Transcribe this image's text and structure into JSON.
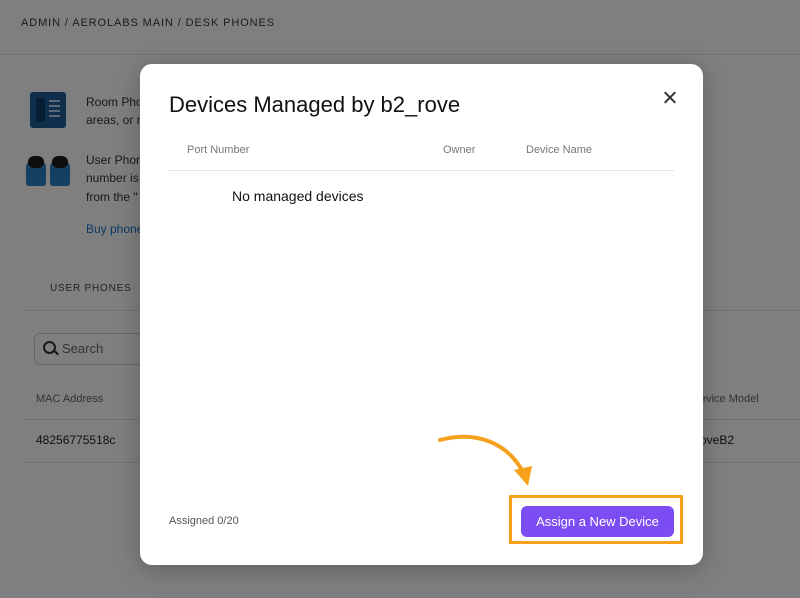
{
  "background": {
    "breadcrumb": "ADMIN / AEROLABS MAIN / DESK PHONES",
    "room_phones_heading": "Room Phon",
    "room_phones_desc": "areas, or r",
    "user_phones_heading": "User Phon",
    "user_phones_desc_1": "number is",
    "user_phones_desc_2": "from the \"",
    "buy_link": "Buy phone",
    "tab_user_phones": "USER PHONES",
    "search_placeholder": "Search",
    "columns": {
      "mac": "MAC Address",
      "model": "evice Model"
    },
    "row": {
      "mac": "48256775518c",
      "model": "oveB2"
    }
  },
  "modal": {
    "title": "Devices Managed by b2_rove",
    "columns": [
      "Port Number",
      "Owner",
      "Device Name"
    ],
    "empty_message": "No managed devices",
    "assigned": "Assigned 0/20",
    "assign_button": "Assign a New Device"
  },
  "colors": {
    "accent": "#7b4df2",
    "highlight": "#f5a11c"
  },
  "icons": [
    "phone-icon",
    "users-icon",
    "search-icon",
    "close-icon",
    "arrow-icon"
  ]
}
